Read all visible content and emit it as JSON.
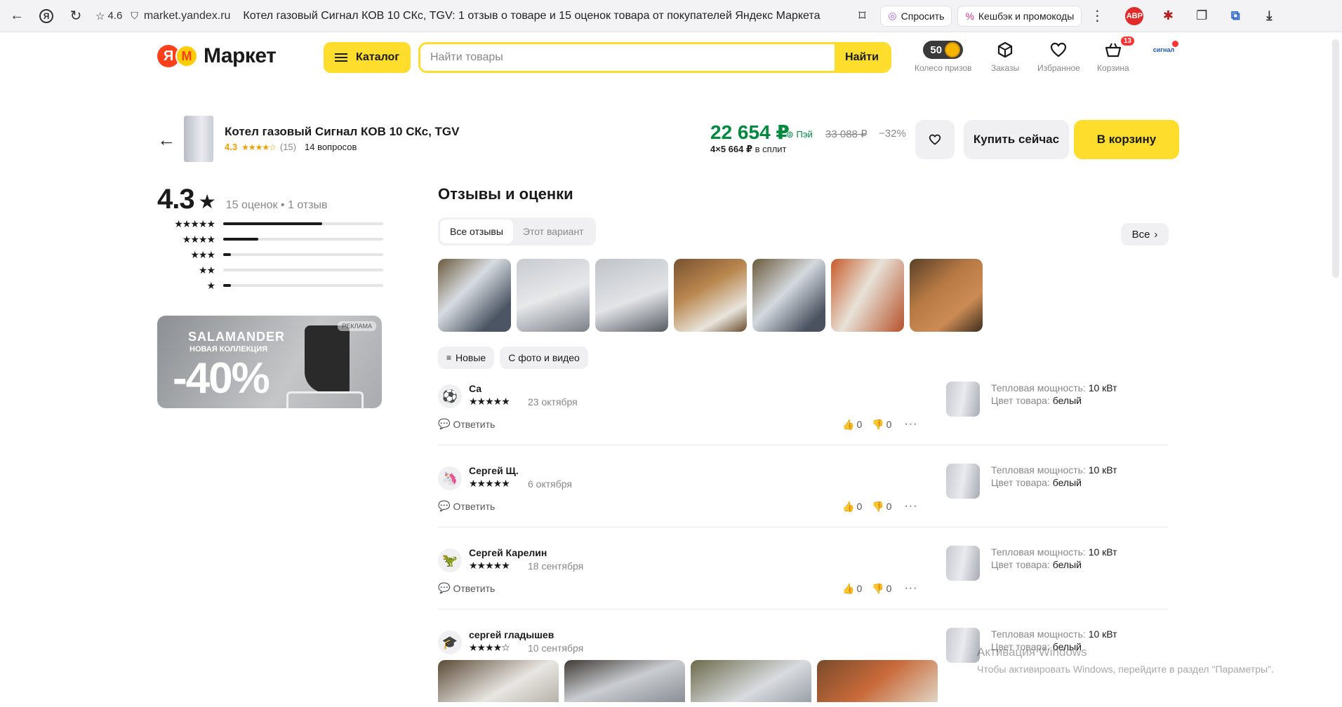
{
  "browser": {
    "rating": "4.6",
    "url": "market.yandex.ru",
    "title": "Котел газовый Сигнал КОВ 10 СКс, TGV: 1 отзыв о товаре и 15 оценок товара от покупателей Яндекс Маркета",
    "ask_label": "Спросить",
    "cashback_label": "Кешбэк и промокоды",
    "abp_label": "ABP"
  },
  "header": {
    "logo_text": "Маркет",
    "logo_letter": "Я",
    "catalog_label": "Каталог",
    "search_placeholder": "Найти товары",
    "search_button": "Найти",
    "coins": "50",
    "wheel_label": "Колесо призов",
    "orders_label": "Заказы",
    "favorites_label": "Избранное",
    "cart_label": "Корзина",
    "cart_count": "13",
    "profile_label": "сигнал"
  },
  "product": {
    "title": "Котел газовый Сигнал КОВ 10 СКс, TGV",
    "rating": "4.3",
    "stars": "★★★★☆",
    "rating_count": "(15)",
    "questions": "14 вопросов",
    "price": "22 654 ₽",
    "pay_label": "Пэй",
    "old_price": "33 088 ₽",
    "discount": "−32%",
    "split_prefix": "4×5 664 ₽",
    "split_suffix": "в сплит",
    "buy_now": "Купить сейчас",
    "to_cart": "В корзину"
  },
  "rating_summary": {
    "value": "4.3",
    "counts": "15 оценок • 1 отзыв",
    "rows": [
      {
        "stars": "★★★★★",
        "fraction": 0.62
      },
      {
        "stars": "★★★★",
        "fraction": 0.22
      },
      {
        "stars": "★★★",
        "fraction": 0.05
      },
      {
        "stars": "★★",
        "fraction": 0.0
      },
      {
        "stars": "★",
        "fraction": 0.05
      }
    ]
  },
  "ad": {
    "brand": "SALAMANDER",
    "subtitle": "НОВАЯ КОЛЛЕКЦИЯ",
    "discount": "-40%",
    "label": "РЕКЛАМА"
  },
  "reviews_section": {
    "title": "Отзывы и оценки",
    "tab_all": "Все отзывы",
    "tab_variant": "Этот вариант",
    "all_button": "Все",
    "filter_new": "Новые",
    "filter_media": "С фото и видео"
  },
  "reviews": [
    {
      "name": "Са",
      "avatar": "⚽",
      "stars": "★★★★★",
      "date": "23 октября",
      "reply": "Ответить",
      "likes": "0",
      "dislikes": "0",
      "power_label": "Тепловая мощность:",
      "power_value": "10 кВт",
      "color_label": "Цвет товара:",
      "color_value": "белый"
    },
    {
      "name": "Сергей Щ.",
      "avatar": "🦄",
      "stars": "★★★★★",
      "date": "6 октября",
      "reply": "Ответить",
      "likes": "0",
      "dislikes": "0",
      "power_label": "Тепловая мощность:",
      "power_value": "10 кВт",
      "color_label": "Цвет товара:",
      "color_value": "белый"
    },
    {
      "name": "Сергей Карелин",
      "avatar": "🦖",
      "stars": "★★★★★",
      "date": "18 сентября",
      "reply": "Ответить",
      "likes": "0",
      "dislikes": "0",
      "power_label": "Тепловая мощность:",
      "power_value": "10 кВт",
      "color_label": "Цвет товара:",
      "color_value": "белый"
    },
    {
      "name": "сергей гладышев",
      "avatar": "🎓",
      "stars": "★★★★☆",
      "date": "10 сентября",
      "power_label": "Тепловая мощность:",
      "power_value": "10 кВт",
      "color_label": "Цвет товара:",
      "color_value": "белый"
    }
  ],
  "watermark": {
    "line1": "Активация Windows",
    "line2": "Чтобы активировать Windows, перейдите в раздел \"Параметры\"."
  }
}
